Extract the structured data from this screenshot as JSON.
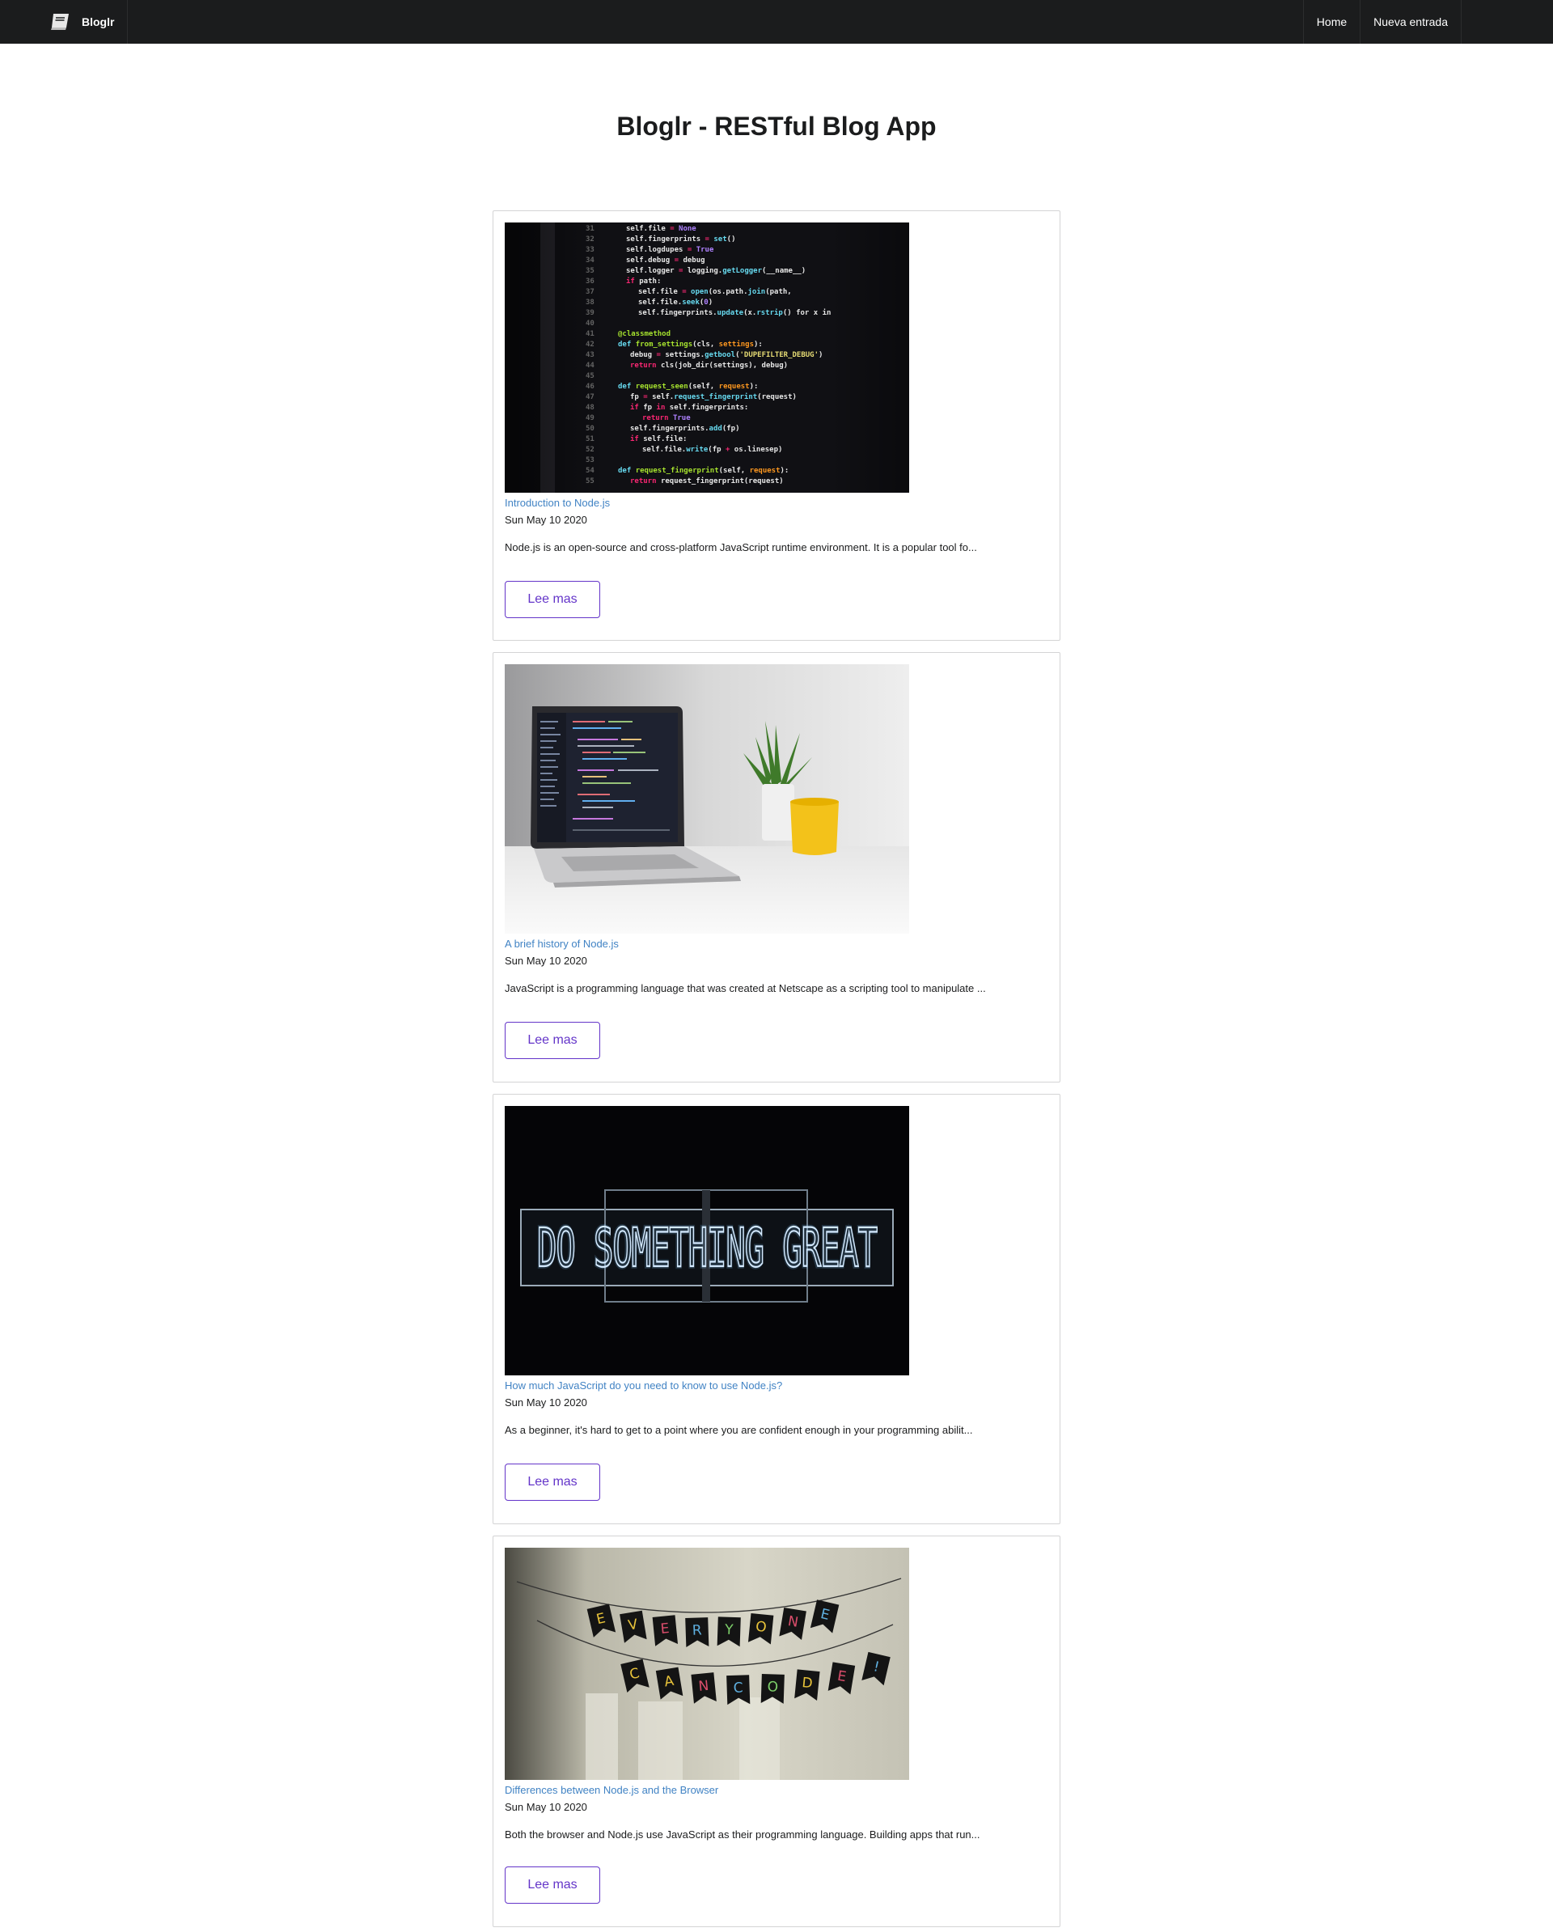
{
  "nav": {
    "brand": "Bloglr",
    "brand_icon": "book-icon",
    "items": [
      {
        "label": "Home"
      },
      {
        "label": "Nueva entrada"
      }
    ]
  },
  "header": {
    "title": "Bloglr - RESTful Blog App"
  },
  "read_more_label": "Lee mas",
  "posts": [
    {
      "title": "Introduction to Node.js",
      "date": "Sun May 10 2020",
      "excerpt": "Node.js is an open-source and cross-platform JavaScript runtime environment. It is a popular tool fo...",
      "image": "code-on-screen-photo"
    },
    {
      "title": "A brief history of Node.js",
      "date": "Sun May 10 2020",
      "excerpt": "JavaScript is a programming language that was created at Netscape as a scripting tool to manipulate ...",
      "image": "laptop-with-plant-photo"
    },
    {
      "title": "How much JavaScript do you need to know to use Node.js?",
      "date": "Sun May 10 2020",
      "excerpt": "As a beginner, it's hard to get to a point where you are confident enough in your programming abilit...",
      "image": "neon-sign-photo",
      "image_text": "DO SOMETHING GREAT"
    },
    {
      "title": "Differences between Node.js and the Browser",
      "date": "Sun May 10 2020",
      "excerpt": "Both the browser and Node.js use JavaScript as their programming language. Building apps that run...",
      "image": "banner-garland-photo",
      "image_text_line1": [
        "E",
        "V",
        "E",
        "R",
        "Y",
        "O",
        "N",
        "E"
      ],
      "image_text_line2": [
        "C",
        "A",
        "N",
        "C",
        "O",
        "D",
        "E",
        "!"
      ]
    }
  ]
}
